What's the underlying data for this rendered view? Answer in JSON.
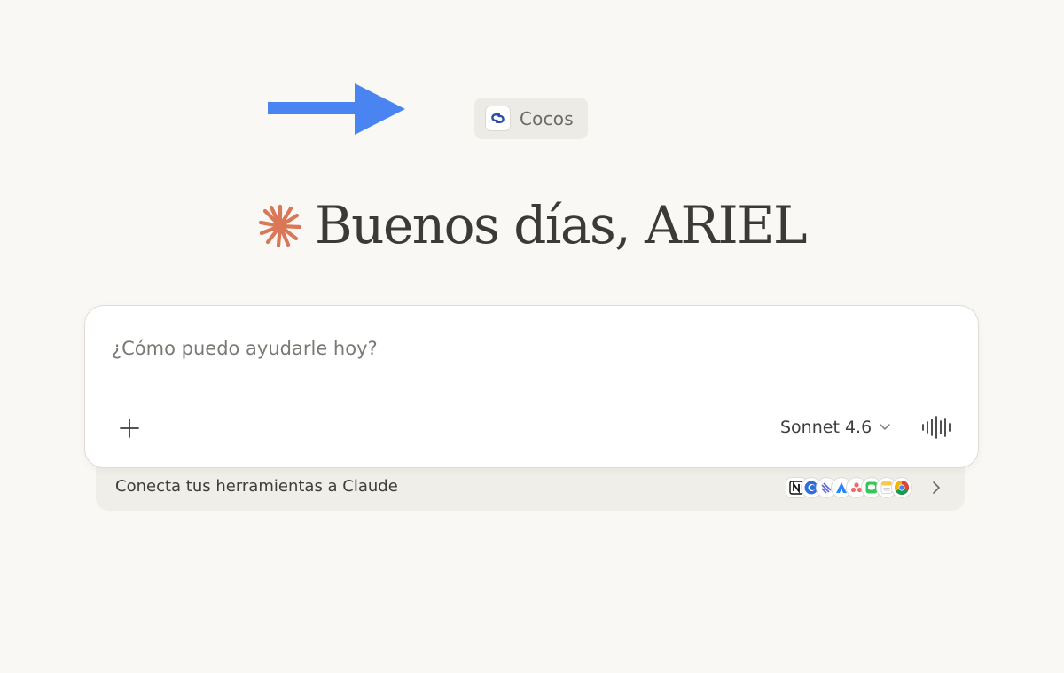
{
  "project": {
    "name": "Cocos",
    "icon": "link-loop-icon",
    "icon_color": "#2a4fa8"
  },
  "greeting": {
    "text": "Buenos días, ARIEL",
    "spark_color": "#d97757"
  },
  "composer": {
    "placeholder": "¿Cómo puedo ayudarle hoy?",
    "value": "",
    "model_label": "Sonnet 4.6",
    "add_icon": "plus-icon",
    "voice_icon": "voice-waveform-icon"
  },
  "tools": {
    "label": "Conecta tus herramientas a Claude",
    "icons": [
      "notion-icon",
      "cursor-icon",
      "linear-icon",
      "atlassian-icon",
      "asana-icon",
      "messages-icon",
      "notes-icon",
      "chrome-icon"
    ]
  },
  "annotation": {
    "arrow_color": "#4a84f0"
  }
}
